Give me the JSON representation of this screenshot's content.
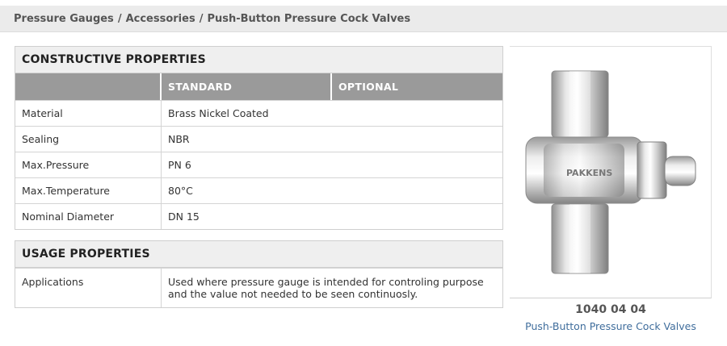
{
  "breadcrumb": {
    "items": [
      "Pressure Gauges",
      "Accessories",
      "Push-Button Pressure Cock Valves"
    ],
    "separator": "/"
  },
  "constructive": {
    "title": "CONSTRUCTIVE PROPERTIES",
    "columns": [
      "",
      "STANDARD",
      "OPTIONAL"
    ],
    "rows": [
      {
        "label": "Material",
        "standard": "Brass Nickel Coated",
        "optional": ""
      },
      {
        "label": "Sealing",
        "standard": "NBR",
        "optional": ""
      },
      {
        "label": "Max.Pressure",
        "standard": "PN 6",
        "optional": ""
      },
      {
        "label": "Max.Temperature",
        "standard": "80°C",
        "optional": ""
      },
      {
        "label": "Nominal Diameter",
        "standard": "DN 15",
        "optional": ""
      }
    ]
  },
  "usage": {
    "title": "USAGE PROPERTIES",
    "rows": [
      {
        "label": "Applications",
        "value": "Used where pressure gauge is intended for controling purpose and the value not needed to be seen continuosly."
      }
    ]
  },
  "product": {
    "code": "1040 04 04",
    "name": "Push-Button Pressure Cock Valves",
    "engraving": "PAKKENS"
  },
  "colors": {
    "breadcrumb_bg": "#ebebeb",
    "header_bg": "#9a9a9a",
    "link": "#3f6d9c"
  }
}
